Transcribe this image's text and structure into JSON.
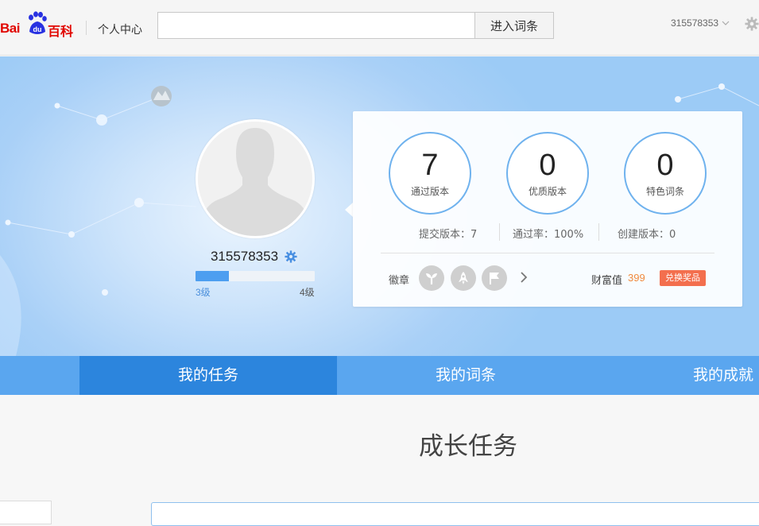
{
  "header": {
    "logo_bai": "Bai",
    "logo_du": "du",
    "logo_baike": "百科",
    "section_label": "个人中心",
    "search_value": "",
    "search_placeholder": "",
    "search_button": "进入词条",
    "username": "315578353"
  },
  "profile": {
    "username": "315578353",
    "level_progress": 0.28,
    "level_from": "3级",
    "level_to": "4级"
  },
  "stats": {
    "passed_versions": {
      "value": "7",
      "label": "通过版本"
    },
    "quality_versions": {
      "value": "0",
      "label": "优质版本"
    },
    "featured_entries": {
      "value": "0",
      "label": "特色词条"
    },
    "submitted": "提交版本：7",
    "pass_rate": "通过率：100%",
    "created": "创建版本：0",
    "badges_label": "徽章",
    "badges": [
      "sprout-icon",
      "rocket-icon",
      "flag-icon"
    ],
    "wealth_label": "财富值",
    "wealth_value": "399",
    "exchange_button": "兑换奖品"
  },
  "tabs": [
    {
      "label": "我的任务",
      "active": true
    },
    {
      "label": "我的词条",
      "active": false
    },
    {
      "label": "我的成就",
      "active": false
    }
  ],
  "content": {
    "title": "成长任务"
  },
  "colors": {
    "brand_red": "#e10601",
    "brand_blue": "#2932e1",
    "tab_bar": "#5aa6ef",
    "tab_active": "#2c85dd",
    "exchange": "#f36f4e",
    "wealth": "#f08a3e"
  }
}
